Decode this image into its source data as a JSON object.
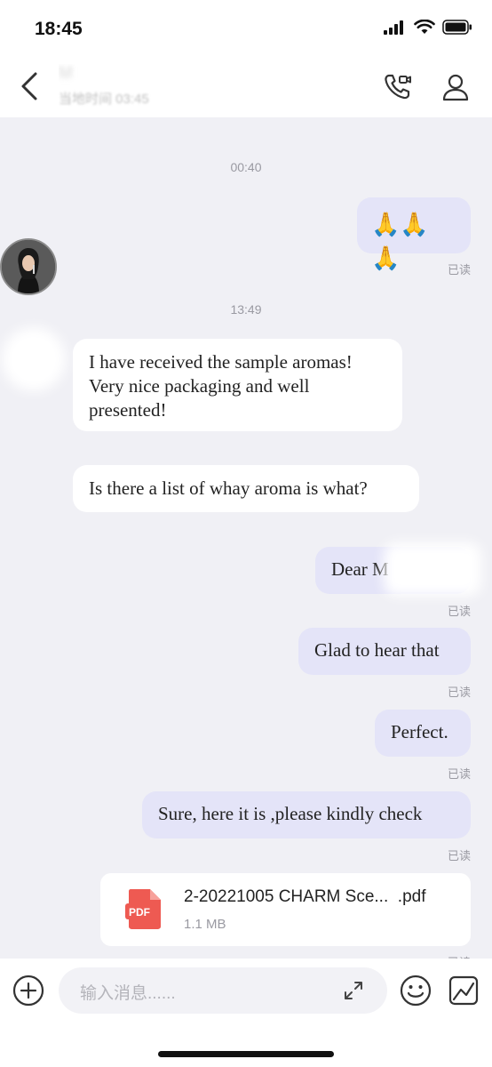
{
  "status_bar": {
    "time": "18:45"
  },
  "header": {
    "contact_name": "M",
    "contact_subtitle": "当地时间 03:45"
  },
  "messages": {
    "ts1": "00:40",
    "emoji": "🙏🙏🙏",
    "ts2": "13:49",
    "in1": "I have received the sample aromas! Very nice packaging and well presented!",
    "in2": "Is there a list of whay aroma is what?",
    "out1": "Dear M",
    "out2": "Glad to hear that",
    "out3": "Perfect.",
    "out4": "Sure, here it is ,please kindly check"
  },
  "read_label": "已读",
  "file": {
    "name": "2-20221005 CHARM Sce...  .pdf",
    "size": "1.1 MB",
    "badge": "PDF"
  },
  "input": {
    "placeholder": "输入消息......"
  },
  "colors": {
    "outgoing_bubble": "#e4e4f8",
    "incoming_bubble": "#ffffff",
    "chat_background": "#f0f0f5",
    "pdf_red": "#ee5a52"
  }
}
